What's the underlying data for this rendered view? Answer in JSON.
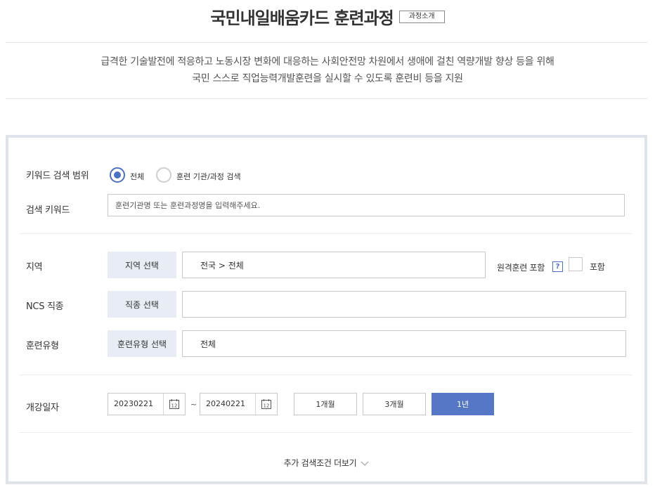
{
  "header": {
    "title": "국민내일배움카드 훈련과정",
    "intro_badge": "과정소개"
  },
  "description": {
    "line1": "급격한 기술발전에 적응하고 노동시장 변화에 대응하는 사회안전망 차원에서 생애에 걸친 역량개발 향상 등을 위해",
    "line2": "국민 스스로 직업능력개발훈련을 실시할 수 있도록 훈련비 등을 지원"
  },
  "search": {
    "scope_label": "키워드 검색 범위",
    "scope_options": [
      {
        "label": "전체",
        "selected": true
      },
      {
        "label": "훈련 기관/과정 검색",
        "selected": false
      }
    ],
    "keyword_label": "검색 키워드",
    "keyword_placeholder": "훈련기관명 또는 훈련과정명을 입력해주세요.",
    "keyword_value": "",
    "region_label": "지역",
    "region_button": "지역 선택",
    "region_value": "전국 > 전체",
    "remote_label": "원격훈련 포함",
    "remote_help": "?",
    "remote_checkbox_label": "포함",
    "remote_checked": false,
    "ncs_label": "NCS 직종",
    "ncs_button": "직종 선택",
    "ncs_value": "",
    "type_label": "훈련유형",
    "type_button": "훈련유형 선택",
    "type_value": "전체",
    "date_label": "개강일자",
    "date_start": "20230221",
    "date_end": "20240221",
    "date_separator": "~",
    "calendar_glyph": "12",
    "periods": [
      {
        "label": "1개월",
        "active": false
      },
      {
        "label": "3개월",
        "active": false
      },
      {
        "label": "1년",
        "active": true
      }
    ],
    "more_toggle": "추가 검색조건 더보기"
  },
  "colors": {
    "accent": "#5577c6",
    "radio_accent": "#4b70c4",
    "panel_border": "#dfe3ec",
    "button_gray": "#e8edf5"
  }
}
